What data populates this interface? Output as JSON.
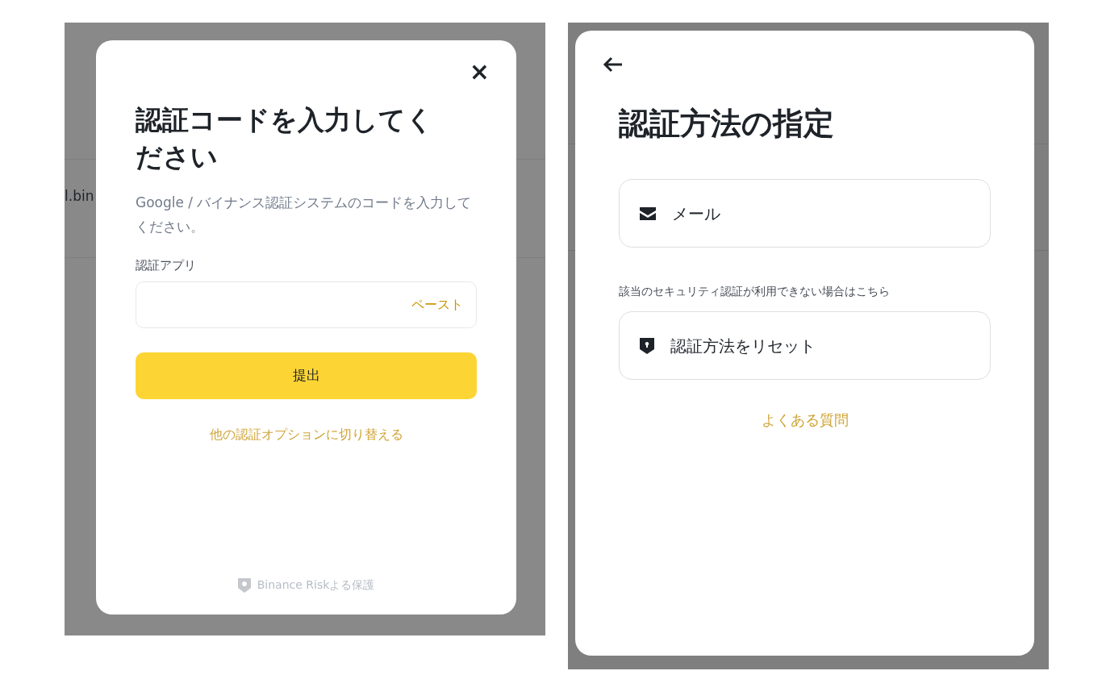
{
  "left_panel": {
    "background_text": "l.bin",
    "dialog": {
      "close": "×",
      "title": "認証コードを入力してください",
      "description": "Google / バイナンス認証システムのコードを入力してください。",
      "field_label": "認証アプリ",
      "field": {
        "paste": "ペースト"
      },
      "submit": "提出",
      "switch_link": "他の認証オプションに切り替える",
      "footer": "Binance Riskよる保護"
    }
  },
  "right_panel": {
    "dialog": {
      "title": "認証方法の指定",
      "options": [
        {
          "kind": "mail",
          "label": "メール"
        }
      ],
      "note": "該当のセキュリティ認証が利用できない場合はこちら",
      "reset": {
        "kind": "shield",
        "label": "認証方法をリセット"
      },
      "faq": "よくある質問"
    }
  }
}
